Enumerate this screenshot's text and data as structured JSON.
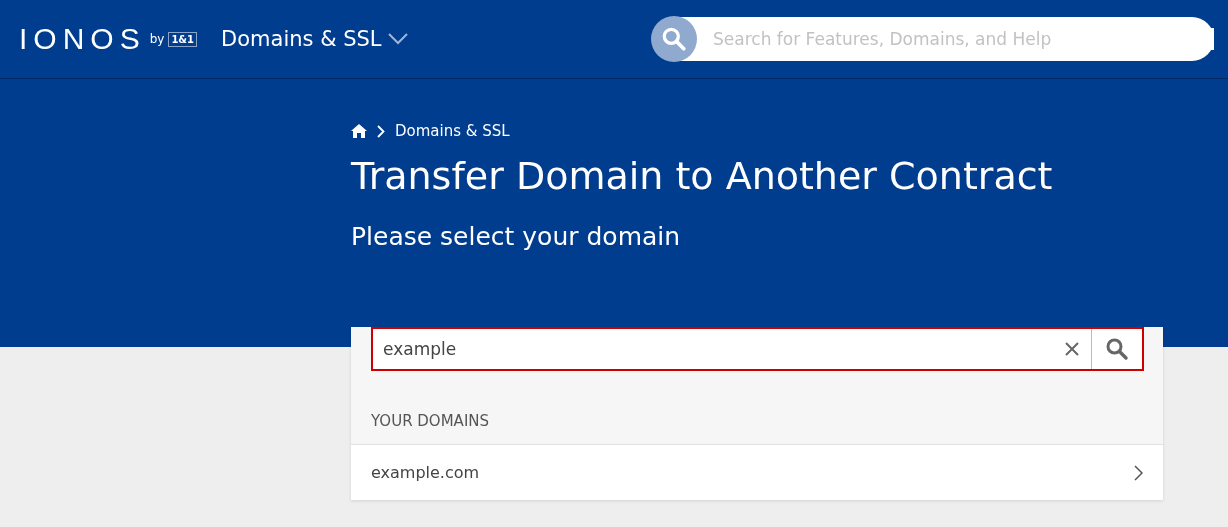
{
  "header": {
    "logo": "IONOS",
    "logo_by": "by",
    "logo_badge": "1&1",
    "section_menu": "Domains & SSL",
    "search": {
      "placeholder": "Search for Features, Domains, and Help"
    }
  },
  "breadcrumb": [
    "Domains & SSL"
  ],
  "title": "Transfer Domain to Another Contract",
  "subtitle": "Please select your domain",
  "domain_search": {
    "value": "example"
  },
  "list_heading": "YOUR DOMAINS",
  "domains": [
    {
      "name": "example.com"
    }
  ]
}
